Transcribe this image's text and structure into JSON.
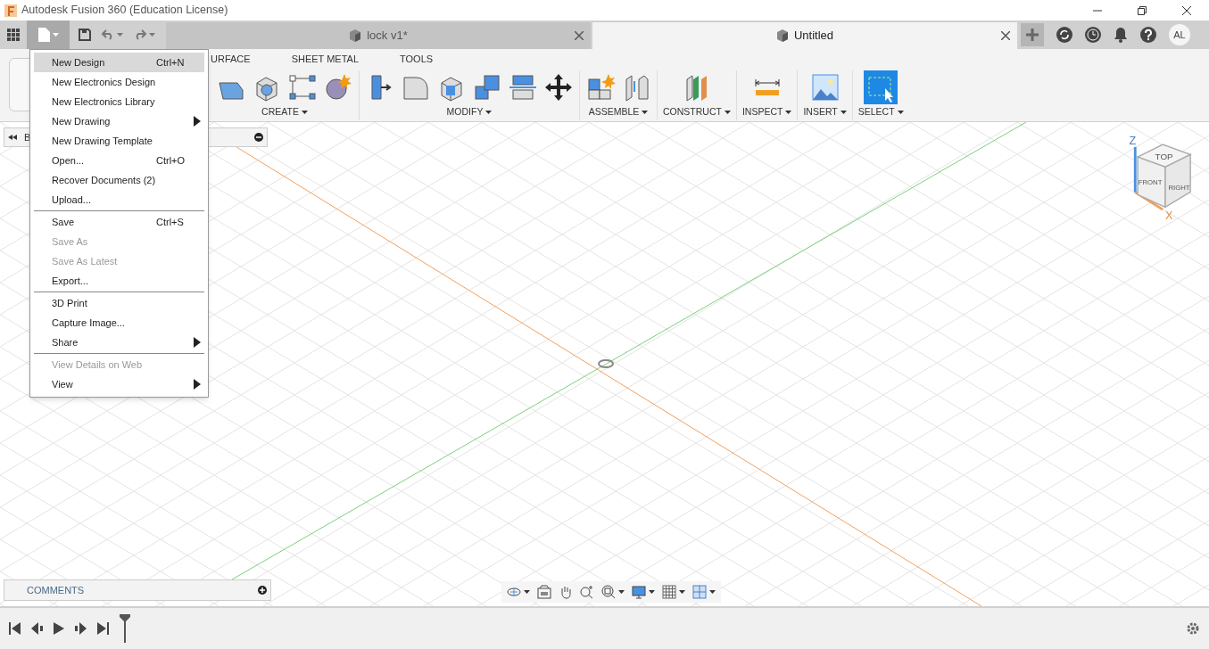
{
  "window": {
    "title": "Autodesk Fusion 360 (Education License)"
  },
  "document_tabs": [
    {
      "label": "lock v1*",
      "selected": false
    },
    {
      "label": "Untitled",
      "selected": true
    }
  ],
  "profile": {
    "initials": "AL"
  },
  "toolbar": {
    "workspace_tabs": [
      {
        "label": "URFACE",
        "selected": false
      },
      {
        "label": "SHEET METAL",
        "selected": false
      },
      {
        "label": "TOOLS",
        "selected": false
      }
    ],
    "groups": [
      {
        "label": "CREATE"
      },
      {
        "label": "MODIFY"
      },
      {
        "label": "ASSEMBLE"
      },
      {
        "label": "CONSTRUCT"
      },
      {
        "label": "INSPECT"
      },
      {
        "label": "INSERT"
      },
      {
        "label": "SELECT"
      }
    ]
  },
  "file_menu": [
    {
      "kind": "item",
      "label": "New Design",
      "shortcut": "Ctrl+N",
      "selected": true,
      "disabled": false,
      "submenu": false
    },
    {
      "kind": "item",
      "label": "New Electronics Design",
      "selected": false,
      "disabled": false,
      "submenu": false
    },
    {
      "kind": "item",
      "label": "New Electronics Library",
      "selected": false,
      "disabled": false,
      "submenu": false
    },
    {
      "kind": "item",
      "label": "New Drawing",
      "selected": false,
      "disabled": false,
      "submenu": true
    },
    {
      "kind": "item",
      "label": "New Drawing Template",
      "selected": false,
      "disabled": false,
      "submenu": false
    },
    {
      "kind": "item",
      "label": "Open...",
      "shortcut": "Ctrl+O",
      "selected": false,
      "disabled": false,
      "submenu": false
    },
    {
      "kind": "item",
      "label": "Recover Documents (2)",
      "selected": false,
      "disabled": false,
      "submenu": false
    },
    {
      "kind": "item",
      "label": "Upload...",
      "selected": false,
      "disabled": false,
      "submenu": false
    },
    {
      "kind": "separator"
    },
    {
      "kind": "item",
      "label": "Save",
      "shortcut": "Ctrl+S",
      "selected": false,
      "disabled": false,
      "submenu": false
    },
    {
      "kind": "item",
      "label": "Save As",
      "selected": false,
      "disabled": true,
      "submenu": false
    },
    {
      "kind": "item",
      "label": "Save As Latest",
      "selected": false,
      "disabled": true,
      "submenu": false
    },
    {
      "kind": "item",
      "label": "Export...",
      "selected": false,
      "disabled": false,
      "submenu": false
    },
    {
      "kind": "separator"
    },
    {
      "kind": "item",
      "label": "3D Print",
      "selected": false,
      "disabled": false,
      "submenu": false
    },
    {
      "kind": "item",
      "label": "Capture Image...",
      "selected": false,
      "disabled": false,
      "submenu": false
    },
    {
      "kind": "item",
      "label": "Share",
      "selected": false,
      "disabled": false,
      "submenu": true
    },
    {
      "kind": "separator"
    },
    {
      "kind": "item",
      "label": "View Details on Web",
      "selected": false,
      "disabled": true,
      "submenu": false
    },
    {
      "kind": "item",
      "label": "View",
      "selected": false,
      "disabled": false,
      "submenu": true
    }
  ],
  "browser_panel": {
    "title": "B"
  },
  "view_cube": {
    "faces": [
      "TOP",
      "FRONT",
      "RIGHT"
    ],
    "axes": [
      "Z",
      "X"
    ]
  },
  "comments_panel": {
    "title": "COMMENTS"
  }
}
